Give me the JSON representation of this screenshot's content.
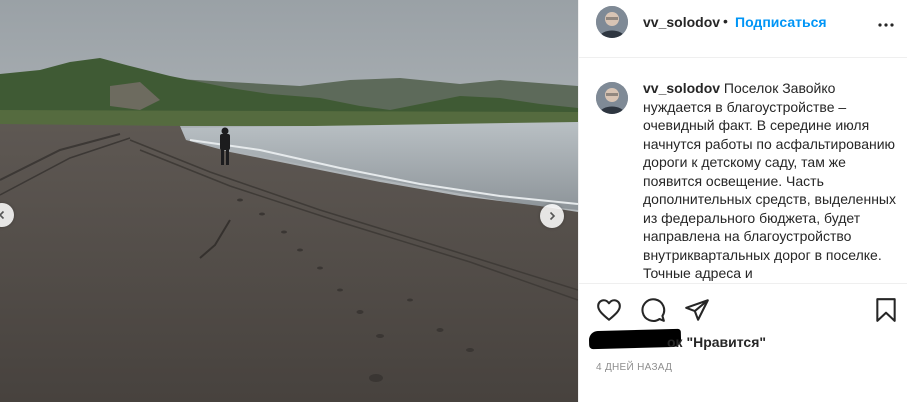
{
  "post": {
    "username": "vv_solodov",
    "follow_label": "Подписаться",
    "header_separator": "•",
    "caption": "Поселок Завойко нуждается в благоустройстве – очевидный факт. В середине июля начнутся работы по асфальтированию дороги к детскому саду, там же появится освещение. Часть дополнительных средств, выделенных из федерального бюджета, будет направлена на благоустройство внутриквартальных дорог в поселке. Точные адреса и",
    "likes_text": "ок \"Нравится\"",
    "timestamp": "4 ДНЕЙ НАЗАД"
  },
  "icons": {
    "more": "more-horizontal-icon",
    "like": "heart-icon",
    "comment": "comment-icon",
    "share": "paper-plane-icon",
    "save": "bookmark-icon",
    "prev": "chevron-left-icon",
    "next": "chevron-right-icon"
  },
  "colors": {
    "accent": "#0095f6",
    "text": "#262626",
    "muted": "#8e8e8e",
    "border": "#efefef"
  }
}
